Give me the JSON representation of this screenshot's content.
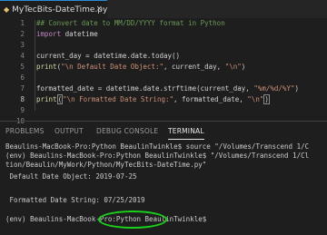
{
  "tab": {
    "filename": "MyTecBits-DateTime.py",
    "close_glyph": "×"
  },
  "editor": {
    "line_numbers": [
      "1",
      "2",
      "3",
      "4",
      "5",
      "6",
      "7",
      "8",
      "9",
      "10"
    ],
    "active_line": "8",
    "line1": "## Convert date to MM/DD/YYYY format in Python",
    "line2_kw": "import",
    "line2_mod": " datetime",
    "line4": "current_day = datetime.date.today()",
    "line5_fn": "print",
    "line5_a": "(",
    "line5_str": "\"\\n Default Date Object:\"",
    "line5_b": ", current_day, ",
    "line5_str2": "\"\\n\"",
    "line5_c": ")",
    "line7_a": "formatted_date = datetime.date.strftime(current_day, ",
    "line7_str": "\"%m/%d/%Y\"",
    "line7_b": ")",
    "line8_fn": "print",
    "line8_paren": "(",
    "line8_str": "\"\\n Formatted Date String:\"",
    "line8_b": ", formatted_date, ",
    "line8_str2": "\"\\n\"",
    "line8_paren_close": ")"
  },
  "panel": {
    "tabs": [
      "PROBLEMS",
      "OUTPUT",
      "DEBUG CONSOLE",
      "TERMINAL"
    ],
    "active_tab": "TERMINAL"
  },
  "terminal": {
    "lines": [
      "Beaulins-MacBook-Pro:Python BeaulinTwinkle$ source \"/Volumes/Transcend 1/C",
      "(env) Beaulins-MacBook-Pro:Python BeaulinTwinkle$ \"/Volumes/Transcend 1/Cl",
      "tion/Beaulin/MyWork/Python/MyTecBits-DateTime.py\"",
      "",
      " Default Date Object: 2019-07-25",
      "",
      "",
      " Formatted Date String: 07/25/2019",
      "",
      "(env) Beaulins-MacBook-Pro:Python BeaulinTwinkle$"
    ]
  },
  "colors": {
    "highlight_circle": "#1ad11a"
  }
}
